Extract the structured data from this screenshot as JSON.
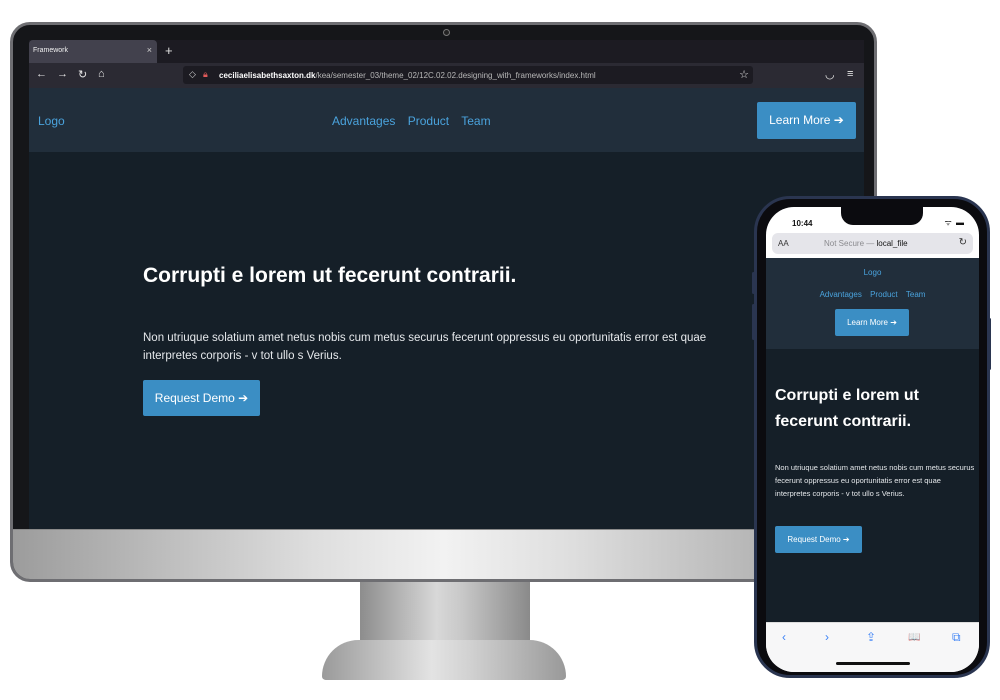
{
  "desktop": {
    "browser": {
      "tab_title": "Framework",
      "tab_close": "×",
      "new_tab": "+",
      "nav_back": "←",
      "nav_forward": "→",
      "nav_reload": "↻",
      "nav_home": "⌂",
      "url_domain": "ceciliaelisabethsaxton.dk",
      "url_path": "/kea/semester_03/theme_02/12C.02.02.designing_with_frameworks/index.html",
      "star": "☆",
      "pocket": "◡",
      "menu": "≡"
    },
    "page": {
      "logo": "Logo",
      "nav": [
        "Advantages",
        "Product",
        "Team"
      ],
      "learn_more": "Learn More ➔",
      "heading": "Corrupti e lorem ut fecerunt contrarii.",
      "paragraph": "Non utriuque solatium amet netus nobis cum metus securus fecerunt oppressus eu oportunitatis error est quae interpretes corporis - v tot ullo s Verius.",
      "cta": "Request Demo ➔"
    }
  },
  "phone": {
    "time": "10:44",
    "status_icons": "ᯤ ▬",
    "aa": "AA",
    "url_prefix": "Not Secure — ",
    "url_host": "local_file",
    "reload": "↻",
    "page": {
      "logo": "Logo",
      "nav": [
        "Advantages",
        "Product",
        "Team"
      ],
      "learn_more": "Learn More ➔",
      "heading": "Corrupti e lorem ut fecerunt contrarii.",
      "paragraph": "Non utriuque solatium amet netus nobis cum metus securus fecerunt oppressus eu oportunitatis error est quae interpretes corporis - v tot ullo s Verius.",
      "cta": "Request Demo ➔"
    },
    "toolbar": {
      "back": "‹",
      "forward": "›",
      "share": "⇪",
      "bookmarks": "📖",
      "tabs": "⧉"
    }
  },
  "colors": {
    "accent": "#3b8ec4",
    "link": "#4aa3dd",
    "nav_bg": "#212e3b",
    "hero_bg": "#151f28"
  }
}
